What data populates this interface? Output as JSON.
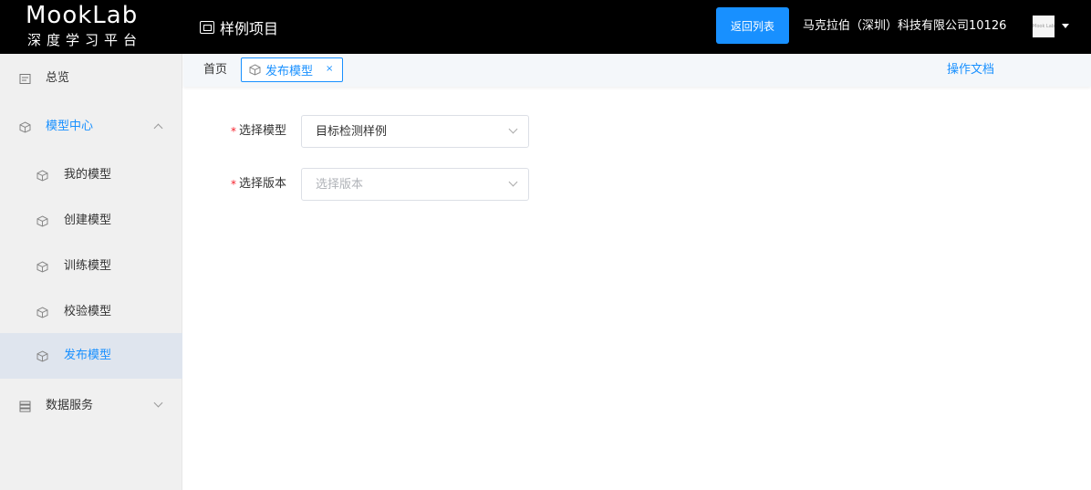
{
  "header": {
    "logo_title": "MookLab",
    "logo_subtitle": "深度学习平台",
    "project_name": "样例项目",
    "back_button": "返回列表",
    "company": "马克拉伯（深圳）科技有限公司10126",
    "avatar_text": "Mook Lab"
  },
  "sidebar": {
    "items": [
      {
        "label": "总览",
        "icon": "overview-icon"
      },
      {
        "label": "模型中心",
        "icon": "cube-icon"
      },
      {
        "label": "我的模型",
        "icon": "cube-icon"
      },
      {
        "label": "创建模型",
        "icon": "cube-add-icon"
      },
      {
        "label": "训练模型",
        "icon": "cube-icon"
      },
      {
        "label": "校验模型",
        "icon": "cube-check-icon"
      },
      {
        "label": "发布模型",
        "icon": "cube-publish-icon"
      },
      {
        "label": "数据服务",
        "icon": "database-icon"
      }
    ]
  },
  "tabs": {
    "home": "首页",
    "active": "发布模型",
    "close": "×",
    "doc_link": "操作文档"
  },
  "form": {
    "model": {
      "required": "*",
      "label": "选择模型",
      "value": "目标检测样例"
    },
    "version": {
      "required": "*",
      "label": "选择版本",
      "placeholder": "选择版本"
    }
  },
  "colors": {
    "accent": "#1890ff",
    "topbar": "#000000",
    "sidebar": "#f0f0f0",
    "selected": "#dfe5ee"
  }
}
